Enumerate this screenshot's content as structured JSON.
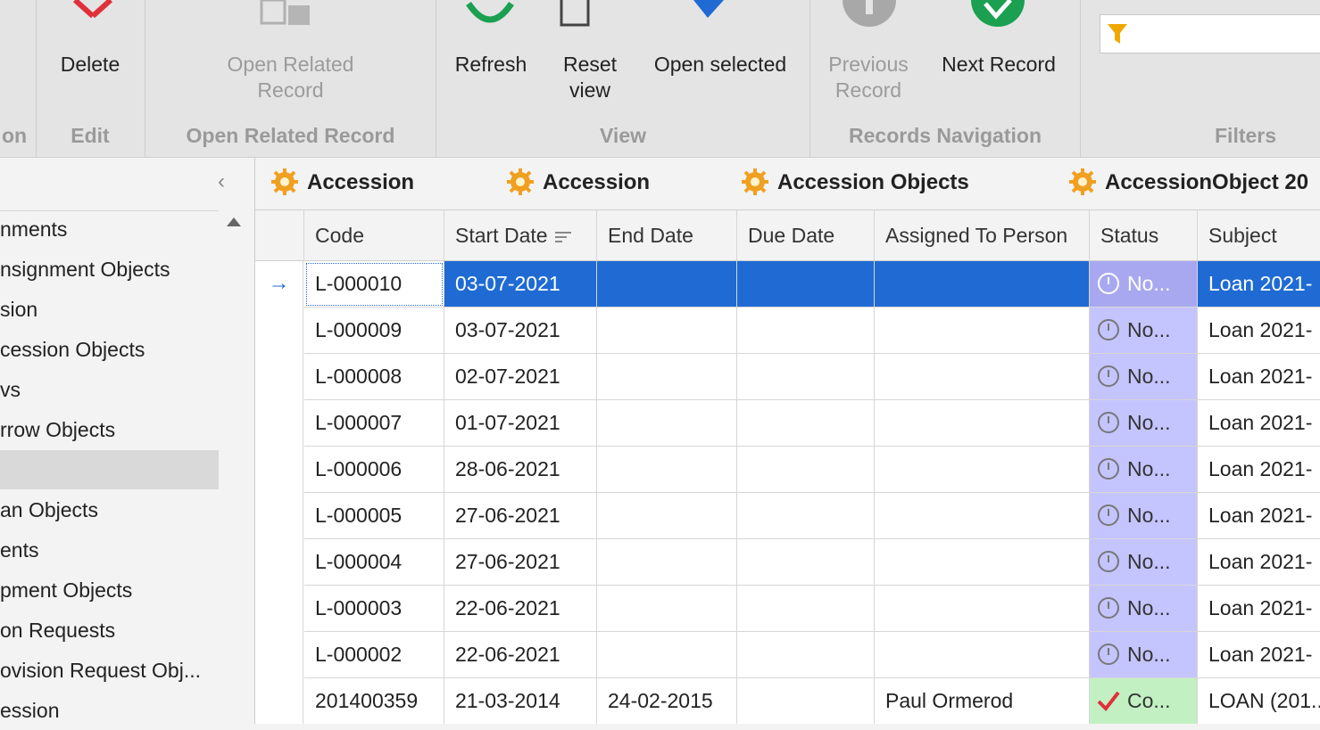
{
  "ribbon": {
    "partial_group_label": "on",
    "edit": {
      "delete_label": "Delete",
      "group_label": "Edit"
    },
    "open_related": {
      "button_label_line1": "Open Related",
      "button_label_line2": "Record",
      "group_label": "Open Related Record"
    },
    "view": {
      "refresh_label": "Refresh",
      "reset_line1": "Reset",
      "reset_line2": "view",
      "open_selected_label": "Open selected",
      "group_label": "View"
    },
    "records_nav": {
      "previous_line1": "Previous",
      "previous_line2": "Record",
      "next_label": "Next Record",
      "group_label": "Records Navigation"
    },
    "filters": {
      "group_label": "Filters",
      "value": ""
    }
  },
  "sidebar": {
    "items": [
      {
        "label": "nments"
      },
      {
        "label": "nsignment Objects"
      },
      {
        "label": "sion"
      },
      {
        "label": "cession Objects"
      },
      {
        "label": "vs"
      },
      {
        "label": "rrow Objects"
      },
      {
        "label": ""
      },
      {
        "label": "an Objects"
      },
      {
        "label": "ents"
      },
      {
        "label": "pment Objects"
      },
      {
        "label": "on Requests"
      },
      {
        "label": "ovision Request Obj..."
      },
      {
        "label": "ession"
      }
    ]
  },
  "tabs": [
    {
      "label": "Accession"
    },
    {
      "label": "Accession"
    },
    {
      "label": "Accession Objects"
    },
    {
      "label": "AccessionObject 20"
    }
  ],
  "grid": {
    "columns": [
      "Code",
      "Start Date",
      "End Date",
      "Due Date",
      "Assigned To Person",
      "Status",
      "Subject"
    ],
    "rows": [
      {
        "code": "L-000010",
        "start": "03-07-2021",
        "end": "",
        "due": "",
        "person": "",
        "status": "No...",
        "subject": "Loan 2021-"
      },
      {
        "code": "L-000009",
        "start": "03-07-2021",
        "end": "",
        "due": "",
        "person": "",
        "status": "No...",
        "subject": "Loan 2021-"
      },
      {
        "code": "L-000008",
        "start": "02-07-2021",
        "end": "",
        "due": "",
        "person": "",
        "status": "No...",
        "subject": "Loan 2021-"
      },
      {
        "code": "L-000007",
        "start": "01-07-2021",
        "end": "",
        "due": "",
        "person": "",
        "status": "No...",
        "subject": "Loan 2021-"
      },
      {
        "code": "L-000006",
        "start": "28-06-2021",
        "end": "",
        "due": "",
        "person": "",
        "status": "No...",
        "subject": "Loan 2021-"
      },
      {
        "code": "L-000005",
        "start": "27-06-2021",
        "end": "",
        "due": "",
        "person": "",
        "status": "No...",
        "subject": "Loan 2021-"
      },
      {
        "code": "L-000004",
        "start": "27-06-2021",
        "end": "",
        "due": "",
        "person": "",
        "status": "No...",
        "subject": "Loan 2021-"
      },
      {
        "code": "L-000003",
        "start": "22-06-2021",
        "end": "",
        "due": "",
        "person": "",
        "status": "No...",
        "subject": "Loan 2021-"
      },
      {
        "code": "L-000002",
        "start": "22-06-2021",
        "end": "",
        "due": "",
        "person": "",
        "status": "No...",
        "subject": "Loan 2021-"
      },
      {
        "code": "201400359",
        "start": "21-03-2014",
        "end": "24-02-2015",
        "due": "",
        "person": "Paul   Ormerod",
        "status": "Co...",
        "subject": "LOAN (201..."
      }
    ]
  },
  "colors": {
    "selection": "#1f6bd3",
    "status_pending": "#c4c4ff",
    "status_complete": "#c2f0c2",
    "accent_gear": "#f0a020"
  }
}
